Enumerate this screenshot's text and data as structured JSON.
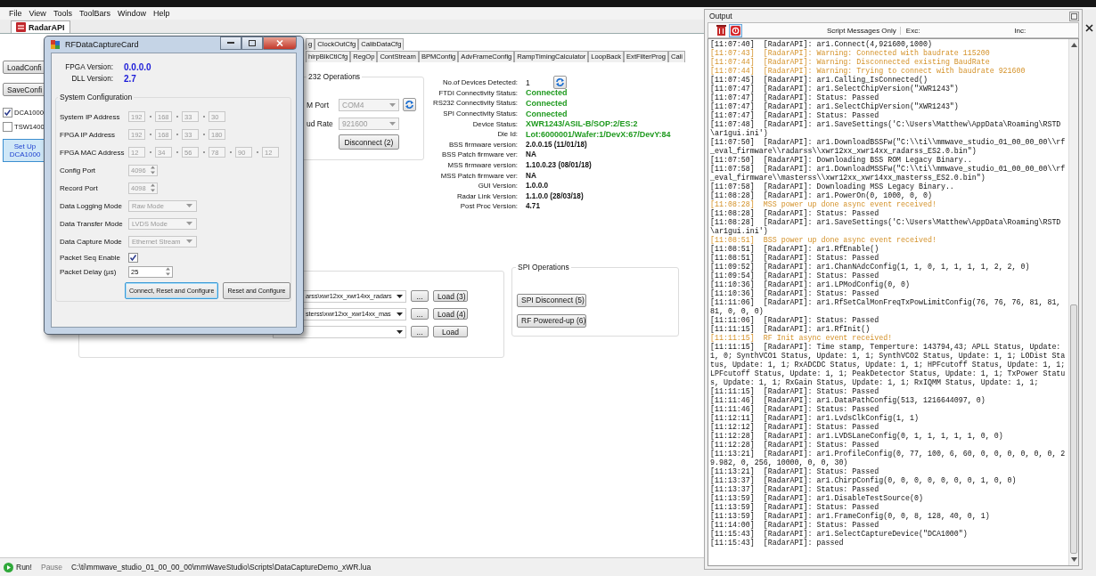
{
  "menu": [
    "File",
    "View",
    "Tools",
    "ToolBars",
    "Window",
    "Help"
  ],
  "doc_tab": {
    "label": "RadarAPI",
    "selected": true
  },
  "left_panel": {
    "buttons": [
      "LoadConfi",
      "SaveConfi"
    ],
    "options": [
      {
        "label": "DCA1000",
        "checked": true
      },
      {
        "label": "TSW1400",
        "checked": false
      }
    ],
    "setup_button": "Set Up DCA1000"
  },
  "tab_rows": [
    [
      {
        "label": "g",
        "selected": false
      },
      {
        "label": "ClockOutCfg",
        "selected": false
      },
      {
        "label": "CalibDataCfg",
        "selected": false
      }
    ],
    [
      {
        "label": "hirpBlkCtlCfg",
        "selected": false
      },
      {
        "label": "RegOp",
        "selected": false
      },
      {
        "label": "ContStream",
        "selected": false
      },
      {
        "label": "BPMConfig",
        "selected": false
      },
      {
        "label": "AdvFrameConfig",
        "selected": false
      },
      {
        "label": "RampTimingCalculator",
        "selected": false
      },
      {
        "label": "LoopBack",
        "selected": false
      },
      {
        "label": "ExtFilterProg",
        "selected": false
      },
      {
        "label": "Cali",
        "selected": false
      }
    ]
  ],
  "rs232": {
    "title": "232 Operations",
    "port_label": "M Port",
    "port": "COM4",
    "baud_label": "ud Rate",
    "baud": "921600",
    "disconnect": "Disconnect (2)"
  },
  "device_info": [
    {
      "label": "No.of Devices Detected:",
      "value": "1",
      "kind": "count"
    },
    {
      "label": "FTDI Connectivity Status:",
      "value": "Connected",
      "kind": "status"
    },
    {
      "label": "RS232 Connectivity Status:",
      "value": "Connected",
      "kind": "status"
    },
    {
      "label": "SPI Connectivity Status:",
      "value": "Connected",
      "kind": "status"
    },
    {
      "label": "Device Status:",
      "value": "XWR1243/ASIL-B/SOP:2/ES:2",
      "kind": "status"
    },
    {
      "label": "Die Id:",
      "value": "Lot:6000001/Wafer:1/DevX:67/DevY:84",
      "kind": "status"
    },
    {
      "label": "BSS firmware version:",
      "value": "2.0.0.15 (11/01/18)",
      "kind": "plain"
    },
    {
      "label": "BSS Patch firmware ver:",
      "value": "NA",
      "kind": "plain"
    },
    {
      "label": "MSS firmware version:",
      "value": "1.10.0.23 (08/01/18)",
      "kind": "plain"
    },
    {
      "label": "MSS Patch firmware ver:",
      "value": "NA",
      "kind": "plain"
    },
    {
      "label": "GUI Version:",
      "value": "1.0.0.0",
      "kind": "plain"
    },
    {
      "label": "Radar Link Version:",
      "value": "1.1.0.0 (28/03/18)",
      "kind": "plain"
    },
    {
      "label": "Post Proc Version:",
      "value": "4.71",
      "kind": "plain"
    }
  ],
  "firmware_loads": [
    {
      "path": "arss\\xwr12xx_xwr14xx_radars",
      "browse": "...",
      "load": "Load (3)"
    },
    {
      "path": "sterss\\xwr12xx_xwr14xx_mas",
      "browse": "...",
      "load": "Load (4)"
    },
    {
      "browse": "...",
      "load": "Load"
    }
  ],
  "spi": {
    "title": "SPI Operations",
    "buttons": [
      "SPI Disconnect (5)",
      "RF Powered-up (6)"
    ]
  },
  "status_bar": {
    "run": "Run!",
    "pause": "Pause",
    "script": "C:\\ti\\mmwave_studio_01_00_00_00\\mmWaveStudio\\Scripts\\DataCaptureDemo_xWR.lua"
  },
  "dialog": {
    "title": "RFDataCaptureCard",
    "versions": [
      {
        "label": "FPGA Version:",
        "value": "0.0.0.0"
      },
      {
        "label": "DLL Version:",
        "value": "2.7"
      }
    ],
    "group_title": "System Configuration",
    "rows": [
      {
        "label": "System IP Address",
        "kind": "octets",
        "values": [
          "192",
          "168",
          "33",
          "30"
        ],
        "disabled": true
      },
      {
        "label": "FPGA IP Address",
        "kind": "octets",
        "values": [
          "192",
          "168",
          "33",
          "180"
        ],
        "disabled": true
      },
      {
        "label": "FPGA MAC Address",
        "kind": "octets",
        "values": [
          "12",
          "34",
          "56",
          "78",
          "90",
          "12"
        ],
        "disabled": true
      },
      {
        "label": "Config Port",
        "kind": "spinner",
        "value": "4096",
        "disabled": true
      },
      {
        "label": "Record Port",
        "kind": "spinner",
        "value": "4098",
        "disabled": true
      },
      {
        "label": "Data Logging Mode",
        "kind": "select",
        "value": "Raw Mode",
        "disabled": true
      },
      {
        "label": "Data Transfer Mode",
        "kind": "select",
        "value": "LVDS Mode",
        "disabled": true
      },
      {
        "label": "Data Capture Mode",
        "kind": "select",
        "value": "Ethernet Stream",
        "disabled": true
      },
      {
        "label": "Packet Seq Enable",
        "kind": "checkbox",
        "checked": true
      },
      {
        "label": "Packet Delay (µs)",
        "kind": "spinner",
        "value": "25",
        "disabled": false
      }
    ],
    "buttons": [
      {
        "label": "Connect, Reset and Configure",
        "selected": true
      },
      {
        "label": "Reset and Configure",
        "selected": false
      }
    ]
  },
  "output": {
    "title": "Output",
    "filter": "Script Messages Only",
    "exc": "Exc:",
    "inc": "Inc:",
    "lines": [
      {
        "kind": "normal",
        "text": "[11:07:40]  [RadarAPI]: ar1.Connect(4,921600,1000)"
      },
      {
        "kind": "highlight",
        "text": "[11:07:43]  [RadarAPI]: Warning: Connected with baudrate 115200"
      },
      {
        "kind": "highlight",
        "text": "[11:07:44]  [RadarAPI]: Warning: Disconnected existing BaudRate"
      },
      {
        "kind": "highlight",
        "text": "[11:07:44]  [RadarAPI]: Warning: Trying to connect with baudrate 921600"
      },
      {
        "kind": "normal",
        "text": "[11:07:45]  [RadarAPI]: ar1.Calling_IsConnected()"
      },
      {
        "kind": "normal",
        "text": "[11:07:47]  [RadarAPI]: ar1.SelectChipVersion(\"XWR1243\")"
      },
      {
        "kind": "normal",
        "text": "[11:07:47]  [RadarAPI]: Status: Passed"
      },
      {
        "kind": "normal",
        "text": "[11:07:47]  [RadarAPI]: ar1.SelectChipVersion(\"XWR1243\")"
      },
      {
        "kind": "normal",
        "text": "[11:07:47]  [RadarAPI]: Status: Passed"
      },
      {
        "kind": "normal",
        "text": "[11:07:48]  [RadarAPI]: ar1.SaveSettings('C:\\Users\\Matthew\\AppData\\Roaming\\RSTD\\ar1gui.ini')"
      },
      {
        "kind": "normal",
        "text": "[11:07:50]  [RadarAPI]: ar1.DownloadBSSFw(\"C:\\\\ti\\\\mmwave_studio_01_00_00_00\\\\rf_eval_firmware\\\\radarss\\\\xwr12xx_xwr14xx_radarss_ES2.0.bin\")"
      },
      {
        "kind": "normal",
        "text": "[11:07:50]  [RadarAPI]: Downloading BSS ROM Legacy Binary.."
      },
      {
        "kind": "normal",
        "text": "[11:07:58]  [RadarAPI]: ar1.DownloadMSSFw(\"C:\\\\ti\\\\mmwave_studio_01_00_00_00\\\\rf_eval_firmware\\\\masterss\\\\xwr12xx_xwr14xx_masterss_ES2.0.bin\")"
      },
      {
        "kind": "normal",
        "text": "[11:07:58]  [RadarAPI]: Downloading MSS Legacy Binary.."
      },
      {
        "kind": "normal",
        "text": "[11:08:28]  [RadarAPI]: ar1.PowerOn(0, 1000, 0, 0)"
      },
      {
        "kind": "highlight",
        "text": "[11:08:28]  MSS power up done async event received!"
      },
      {
        "kind": "normal",
        "text": "[11:08:28]  [RadarAPI]: Status: Passed"
      },
      {
        "kind": "normal",
        "text": "[11:08:28]  [RadarAPI]: ar1.SaveSettings('C:\\Users\\Matthew\\AppData\\Roaming\\RSTD\\ar1gui.ini')"
      },
      {
        "kind": "highlight",
        "text": "[11:08:51]  BSS power up done async event received!"
      },
      {
        "kind": "normal",
        "text": "[11:08:51]  [RadarAPI]: ar1.RfEnable()"
      },
      {
        "kind": "normal",
        "text": "[11:08:51]  [RadarAPI]: Status: Passed"
      },
      {
        "kind": "normal",
        "text": "[11:09:52]  [RadarAPI]: ar1.ChanNAdcConfig(1, 1, 0, 1, 1, 1, 1, 2, 2, 0)"
      },
      {
        "kind": "normal",
        "text": "[11:09:54]  [RadarAPI]: Status: Passed"
      },
      {
        "kind": "normal",
        "text": "[11:10:36]  [RadarAPI]: ar1.LPModConfig(0, 0)"
      },
      {
        "kind": "normal",
        "text": "[11:10:36]  [RadarAPI]: Status: Passed"
      },
      {
        "kind": "normal",
        "text": "[11:11:06]  [RadarAPI]: ar1.RfSetCalMonFreqTxPowLimitConfig(76, 76, 76, 81, 81, 81, 0, 0, 0)"
      },
      {
        "kind": "normal",
        "text": "[11:11:06]  [RadarAPI]: Status: Passed"
      },
      {
        "kind": "normal",
        "text": "[11:11:15]  [RadarAPI]: ar1.RfInit()"
      },
      {
        "kind": "highlight",
        "text": "[11:11:15]  RF Init async event received!"
      },
      {
        "kind": "normal",
        "text": "[11:11:15]  [RadarAPI]: Time stamp, Temperture: 143794,43; APLL Status, Update: 1, 0; SynthVCO1 Status, Update: 1, 1; SynthVCO2 Status, Update: 1, 1; LODist Status, Update: 1, 1; RxADCDC Status, Update: 1, 1; HPFcutoff Status, Update: 1, 1; LPFcutoff Status, Update: 1, 1; PeakDetector Status, Update: 1, 1; TxPower Status, Update: 1, 1; RxGain Status, Update: 1, 1; RxIQMM Status, Update: 1, 1;"
      },
      {
        "kind": "normal",
        "text": "[11:11:15]  [RadarAPI]: Status: Passed"
      },
      {
        "kind": "normal",
        "text": "[11:11:46]  [RadarAPI]: ar1.DataPathConfig(513, 1216644097, 0)"
      },
      {
        "kind": "normal",
        "text": "[11:11:46]  [RadarAPI]: Status: Passed"
      },
      {
        "kind": "normal",
        "text": "[11:12:11]  [RadarAPI]: ar1.LvdsClkConfig(1, 1)"
      },
      {
        "kind": "normal",
        "text": "[11:12:12]  [RadarAPI]: Status: Passed"
      },
      {
        "kind": "normal",
        "text": "[11:12:28]  [RadarAPI]: ar1.LVDSLaneConfig(0, 1, 1, 1, 1, 1, 0, 0)"
      },
      {
        "kind": "normal",
        "text": "[11:12:28]  [RadarAPI]: Status: Passed"
      },
      {
        "kind": "normal",
        "text": "[11:13:21]  [RadarAPI]: ar1.ProfileConfig(0, 77, 100, 6, 60, 0, 0, 0, 0, 0, 0, 29.982, 0, 256, 10000, 0, 0, 30)"
      },
      {
        "kind": "normal",
        "text": "[11:13:21]  [RadarAPI]: Status: Passed"
      },
      {
        "kind": "normal",
        "text": "[11:13:37]  [RadarAPI]: ar1.ChirpConfig(0, 0, 0, 0, 0, 0, 0, 1, 0, 0)"
      },
      {
        "kind": "normal",
        "text": "[11:13:37]  [RadarAPI]: Status: Passed"
      },
      {
        "kind": "normal",
        "text": "[11:13:59]  [RadarAPI]: ar1.DisableTestSource(0)"
      },
      {
        "kind": "normal",
        "text": "[11:13:59]  [RadarAPI]: Status: Passed"
      },
      {
        "kind": "normal",
        "text": "[11:13:59]  [RadarAPI]: ar1.FrameConfig(0, 0, 8, 128, 40, 0, 1)"
      },
      {
        "kind": "normal",
        "text": "[11:14:00]  [RadarAPI]: Status: Passed"
      },
      {
        "kind": "normal",
        "text": "[11:15:43]  [RadarAPI]: ar1.SelectCaptureDevice(\"DCA1000\")"
      },
      {
        "kind": "normal",
        "text": "[11:15:43]  [RadarAPI]: passed"
      }
    ]
  }
}
